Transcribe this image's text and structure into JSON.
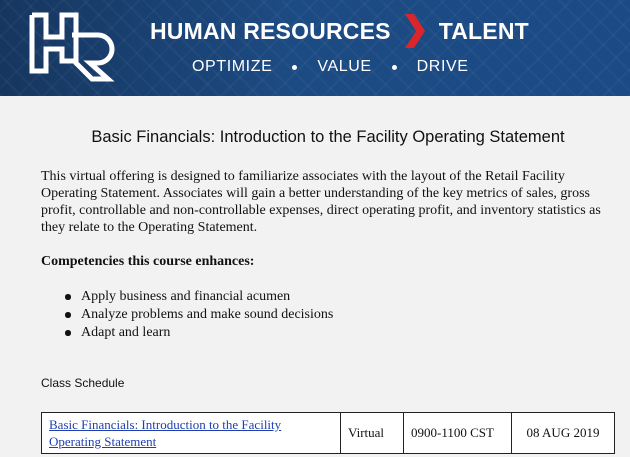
{
  "banner": {
    "logo_text": "HR",
    "title_left": "HUMAN RESOURCES",
    "title_right": "TALENT",
    "subtitle_items": [
      "OPTIMIZE",
      "VALUE",
      "DRIVE"
    ],
    "colors": {
      "background": "#1b4a85",
      "accent_chevron": "#d9262b",
      "text": "#ffffff"
    }
  },
  "page_title": "Basic Financials: Introduction to the Facility Operating Statement",
  "description": "This virtual offering is designed to familiarize associates with the layout of the Retail Facility Operating Statement. Associates will gain a better understanding of the key metrics of sales, gross profit, controllable and non-controllable expenses, direct operating profit, and inventory statistics as they relate to the Operating Statement.",
  "competencies": {
    "heading": "Competencies this course enhances:",
    "items": [
      "Apply business and financial acumen",
      "Analyze problems and make sound decisions",
      "Adapt and learn"
    ]
  },
  "schedule": {
    "heading": "Class Schedule",
    "rows": [
      {
        "course": "Basic Financials: Introduction to the Facility Operating Statement",
        "format": "Virtual",
        "time": "0900-1100 CST",
        "date": "08 AUG 2019"
      }
    ]
  }
}
